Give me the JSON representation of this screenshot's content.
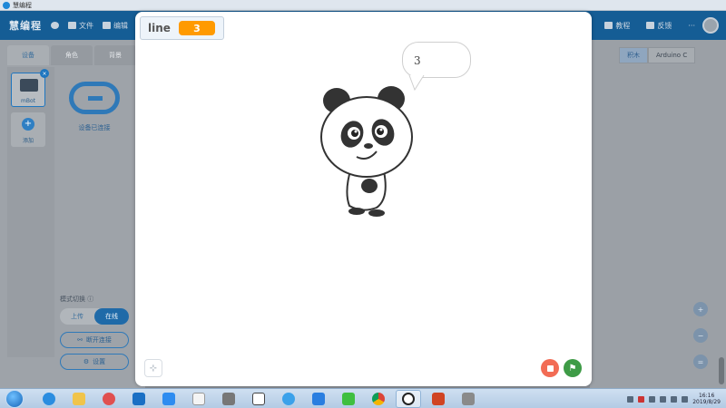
{
  "window": {
    "title": "慧编程"
  },
  "header": {
    "brand": "慧编程",
    "menu": [
      {
        "label": "",
        "icon": "globe-icon"
      },
      {
        "label": "文件",
        "icon": "folder-icon"
      },
      {
        "label": "编辑",
        "icon": "wrench-icon"
      }
    ],
    "right": [
      {
        "label": "教程",
        "icon": "book-icon"
      },
      {
        "label": "反馈",
        "icon": "feedback-icon"
      },
      {
        "label": "···",
        "icon": "more-icon"
      }
    ]
  },
  "left_panel": {
    "tabs": [
      "设备",
      "角色",
      "背景"
    ],
    "device": {
      "label": "mBot"
    },
    "add_label": "添加",
    "connected_label": "设备已连接",
    "mode_label": "模式切换 ⓘ",
    "mode_options": [
      "上传",
      "在线"
    ],
    "disconnect_label": "断开连接",
    "settings_label": "设置"
  },
  "right_panel": {
    "tabs": [
      "积木",
      "Arduino C"
    ]
  },
  "stage": {
    "variable": {
      "name": "line",
      "value": "3"
    },
    "speech": "3"
  },
  "taskbar": {
    "time": "16:16",
    "date": "2019/8/29"
  },
  "colors": {
    "accent": "#ff9a00",
    "brand_blue": "#1f76bf",
    "stop": "#f26c55",
    "go": "#3e9b46"
  }
}
